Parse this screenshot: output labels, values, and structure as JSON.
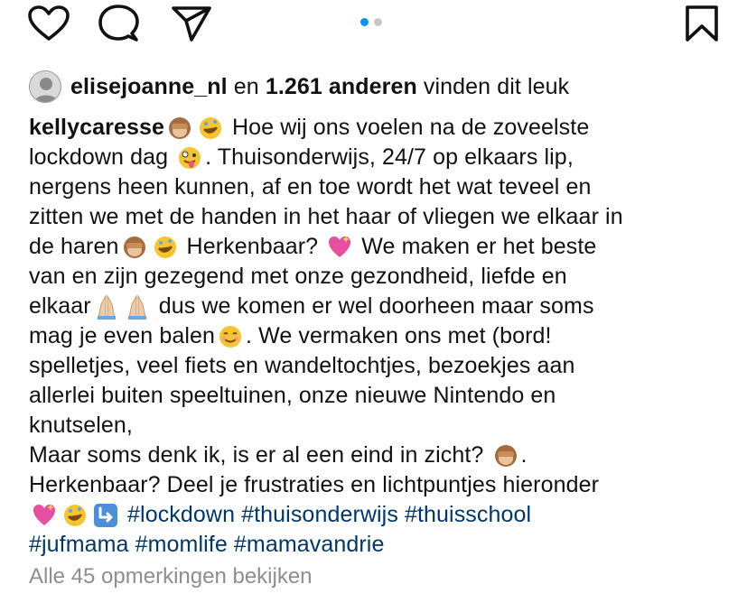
{
  "actions": {
    "like_icon": "heart-icon",
    "comment_icon": "comment-icon",
    "share_icon": "send-icon",
    "save_icon": "bookmark-icon"
  },
  "carousel": {
    "count": 2,
    "active": 1
  },
  "likes": {
    "user": "elisejoanne_nl",
    "connector": " en ",
    "count_text": "1.261 anderen",
    "suffix": " vinden dit leuk"
  },
  "caption": {
    "username": "kellycaresse",
    "l1_text": " Hoe wij ons voelen na de zoveelste",
    "l2_a": "lockdown dag ",
    "l2_b": ". Thuisonderwijs, 24/7 op elkaars lip,",
    "l3": "nergens heen kunnen, af en toe wordt het wat teveel en",
    "l4": "zitten we met de handen in het haar of vliegen we elkaar in",
    "l5_a": "de haren",
    "l5_b": " Herkenbaar? ",
    "l5_c": " We maken er het beste",
    "l6": "van en zijn gezegend met onze gezondheid, liefde en",
    "l7_a": "elkaar",
    "l7_b": " dus we komen er wel doorheen maar soms",
    "l8_a": "mag je even balen",
    "l8_b": ". We vermaken ons met (bord!",
    "l9": "spelletjes, veel fiets en wandeltochtjes, bezoekjes aan",
    "l10": "allerlei buiten speeltuinen, onze nieuwe Nintendo en",
    "l11": "knutselen,",
    "l12_a": "Maar soms denk ik, is er al een eind in zicht? ",
    "l12_b": ".",
    "l13": "Herkenbaar? Deel je frustraties en lichtpuntjes hieronder",
    "hashtags1": [
      "#lockdown",
      "#thuisonderwijs",
      "#thuisschool"
    ],
    "hashtags2": [
      "#jufmama",
      "#momlife",
      "#mamavandrie"
    ]
  },
  "comments_link": "Alle 45 opmerkingen bekijken",
  "colors": {
    "accent": "#0095f6",
    "hashtag": "#00376b",
    "muted": "#8e8e8e"
  }
}
